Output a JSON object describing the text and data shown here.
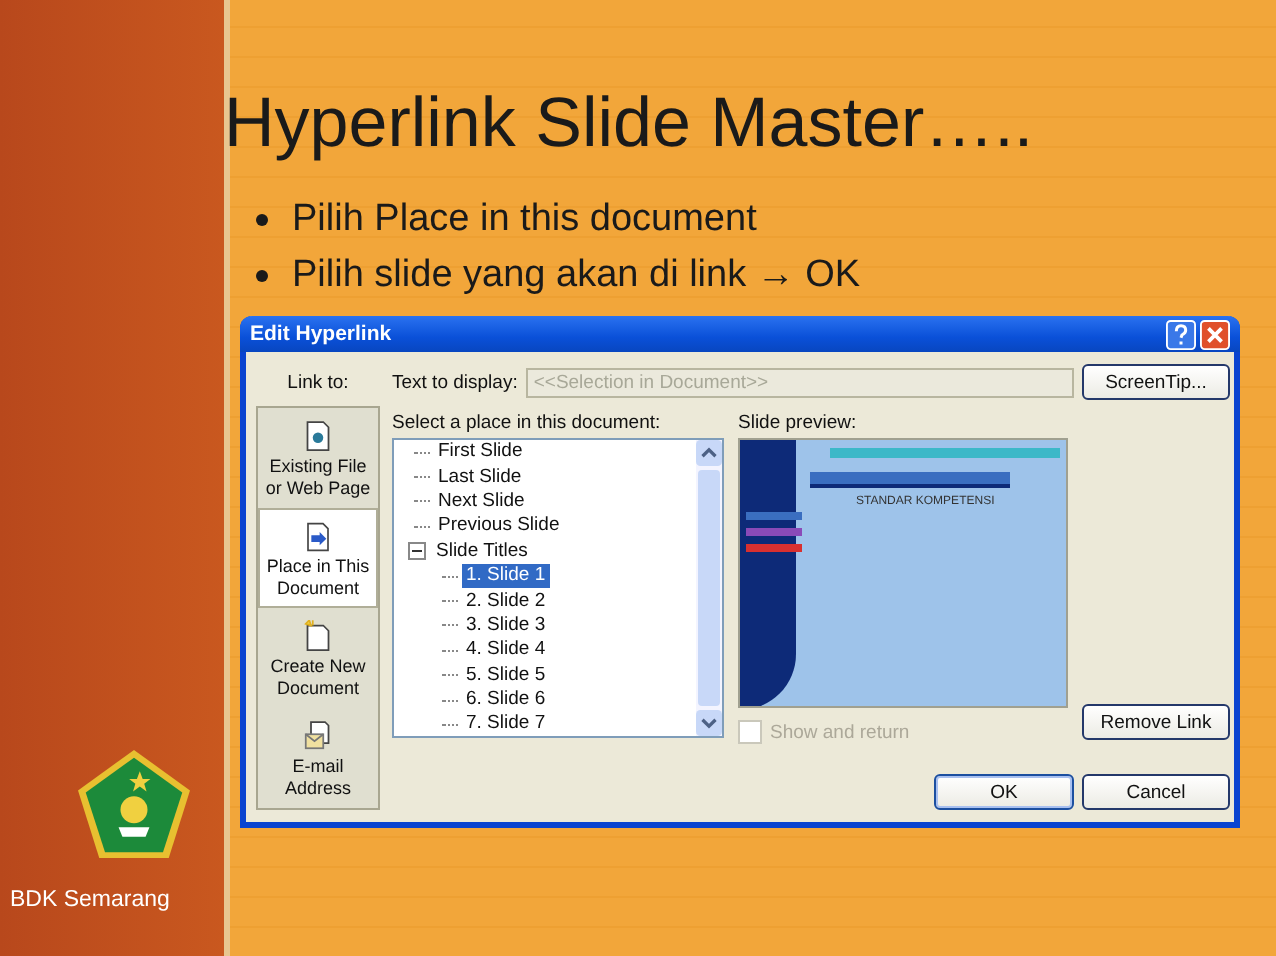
{
  "slide": {
    "title": "Hyperlink Slide Master…..",
    "bullets": [
      "Pilih Place in this document",
      "Pilih slide yang akan di link → OK"
    ],
    "footer": "BDK Semarang"
  },
  "dialog": {
    "title": "Edit Hyperlink",
    "link_to_label": "Link to:",
    "link_bar": [
      {
        "label": "Existing File or Web Page",
        "kind": "file",
        "selected": false
      },
      {
        "label": "Place in This Document",
        "kind": "place",
        "selected": true
      },
      {
        "label": "Create New Document",
        "kind": "new",
        "selected": false
      },
      {
        "label": "E-mail Address",
        "kind": "email",
        "selected": false
      }
    ],
    "text_to_display": {
      "label": "Text to display:",
      "value": "<<Selection in Document>>",
      "disabled": true
    },
    "screentip_button": "ScreenTip...",
    "place_label": "Select a place in this document:",
    "tree": [
      {
        "label": "First Slide",
        "selected": false
      },
      {
        "label": "Last Slide",
        "selected": false
      },
      {
        "label": "Next Slide",
        "selected": false
      },
      {
        "label": "Previous Slide",
        "selected": false
      },
      {
        "label": "Slide Titles",
        "selected": false,
        "expanded": true,
        "children": [
          {
            "label": "1. Slide 1",
            "selected": true
          },
          {
            "label": "2. Slide 2",
            "selected": false
          },
          {
            "label": "3. Slide 3",
            "selected": false
          },
          {
            "label": "4. Slide 4",
            "selected": false
          },
          {
            "label": "5. Slide 5",
            "selected": false
          },
          {
            "label": "6. Slide 6",
            "selected": false
          },
          {
            "label": "7. Slide 7",
            "selected": false
          }
        ]
      }
    ],
    "preview_label": "Slide preview:",
    "preview": {
      "heading": "STANDAR KOMPETENSI"
    },
    "show_and_return": {
      "label": "Show and return",
      "checked": false,
      "disabled": true
    },
    "remove_link_button": "Remove Link",
    "ok_button": "OK",
    "cancel_button": "Cancel"
  }
}
